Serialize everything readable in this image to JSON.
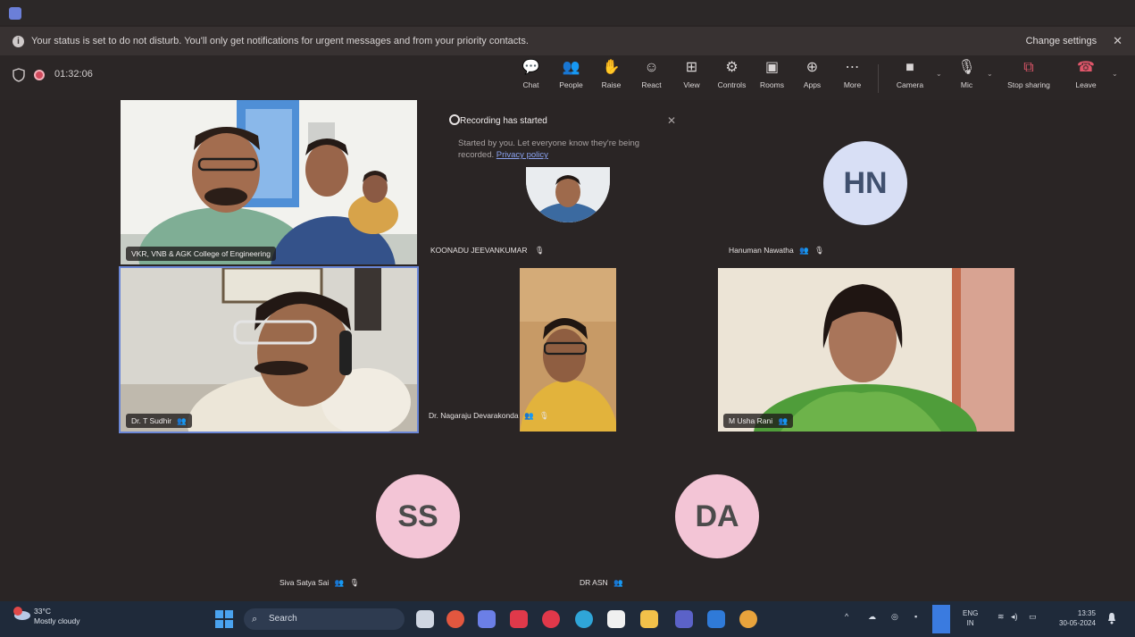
{
  "banner": {
    "info_icon": "i",
    "text": "Your status is set to do not disturb. You'll only get notifications for urgent messages and from your priority contacts.",
    "change_settings": "Change settings",
    "close": "✕"
  },
  "meeting": {
    "timer": "01:32:06"
  },
  "toolbar": {
    "items": [
      {
        "icon": "chat-icon",
        "glyph": "💬",
        "label": "Chat"
      },
      {
        "icon": "people-icon",
        "glyph": "👥",
        "label": "People"
      },
      {
        "icon": "raise-hand-icon",
        "glyph": "✋",
        "label": "Raise"
      },
      {
        "icon": "react-icon",
        "glyph": "☺",
        "label": "React"
      },
      {
        "icon": "view-icon",
        "glyph": "⊞",
        "label": "View"
      },
      {
        "icon": "controls-icon",
        "glyph": "⚙",
        "label": "Controls"
      },
      {
        "icon": "rooms-icon",
        "glyph": "▣",
        "label": "Rooms"
      },
      {
        "icon": "apps-icon",
        "glyph": "⊕",
        "label": "Apps"
      },
      {
        "icon": "more-icon",
        "glyph": "⋯",
        "label": "More"
      }
    ],
    "camera_label": "Camera",
    "mic_label": "Mic",
    "share_label": "Stop sharing",
    "leave_label": "Leave"
  },
  "recording_notice": {
    "title": "Recording has started",
    "body": "Started by you. Let everyone know they're being recorded.",
    "link": "Privacy policy",
    "close": "✕"
  },
  "participants": {
    "college": "VKR, VNB & AGK College of Engineering",
    "sudhir": "Dr. T Sudhir",
    "nagaraju": "Dr. Nagaraju Devarakonda",
    "usha": "M Usha Rani",
    "koonadu": "KOONADU JEEVANKUMAR",
    "hn_name": "Hanuman Nawatha",
    "hn_initials": "HN",
    "ss_name": "Siva Satya Sai",
    "ss_initials": "SS",
    "da_name": "DR ASN",
    "da_initials": "DA"
  },
  "taskbar": {
    "temperature": "33°C",
    "weather": "Mostly cloudy",
    "search": "Search",
    "lang_line1": "ENG",
    "lang_line2": "IN",
    "time": "13:35",
    "date": "30-05-2024"
  },
  "colors": {
    "background": "#2a2525",
    "recording": "#d14a5c",
    "leave": "#e0566a",
    "active_speaker": "#6a86d6",
    "avatar_pink": "#f3c5d6",
    "avatar_blue": "#d8dff5"
  }
}
